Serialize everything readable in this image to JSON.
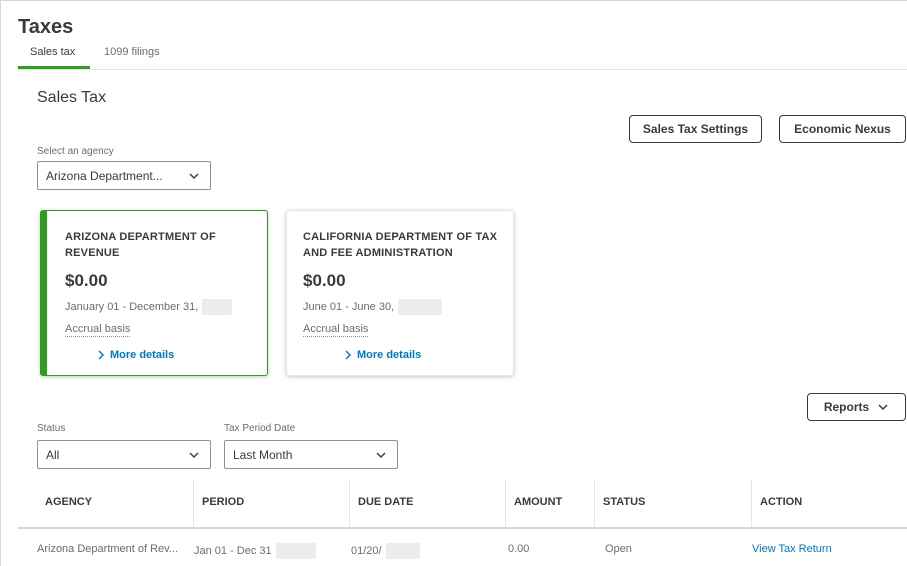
{
  "page": {
    "title": "Taxes"
  },
  "tabs": [
    {
      "label": "Sales tax",
      "active": true
    },
    {
      "label": "1099 filings",
      "active": false
    }
  ],
  "section": {
    "title": "Sales Tax"
  },
  "buttons": {
    "settings": "Sales Tax Settings",
    "nexus": "Economic Nexus",
    "reports": "Reports"
  },
  "agency_select": {
    "label": "Select an agency",
    "value": "Arizona Department..."
  },
  "cards": [
    {
      "title": "ARIZONA DEPARTMENT OF REVENUE",
      "amount": "$0.00",
      "dates": "January 01 - December 31,",
      "basis": "Accrual basis",
      "more": "More details",
      "selected": true
    },
    {
      "title": "CALIFORNIA DEPARTMENT OF TAX AND FEE ADMINISTRATION",
      "amount": "$0.00",
      "dates": "June 01 - June 30,",
      "basis": "Accrual basis",
      "more": "More details",
      "selected": false
    }
  ],
  "filters": {
    "status": {
      "label": "Status",
      "value": "All"
    },
    "period": {
      "label": "Tax Period Date",
      "value": "Last Month"
    }
  },
  "table": {
    "headers": [
      "AGENCY",
      "PERIOD",
      "DUE DATE",
      "AMOUNT",
      "STATUS",
      "ACTION"
    ],
    "rows": [
      {
        "agency": "Arizona Department of Rev...",
        "period": "Jan 01 - Dec 31",
        "due_date": "01/20/",
        "amount": "0.00",
        "status": "Open",
        "action": "View Tax Return"
      }
    ]
  },
  "colors": {
    "accent_green": "#2ca01c",
    "link_blue": "#0077c5",
    "text": "#393a3d",
    "muted": "#6b6c72"
  },
  "icons": [
    "chevron-down-icon",
    "chevron-right-icon"
  ]
}
